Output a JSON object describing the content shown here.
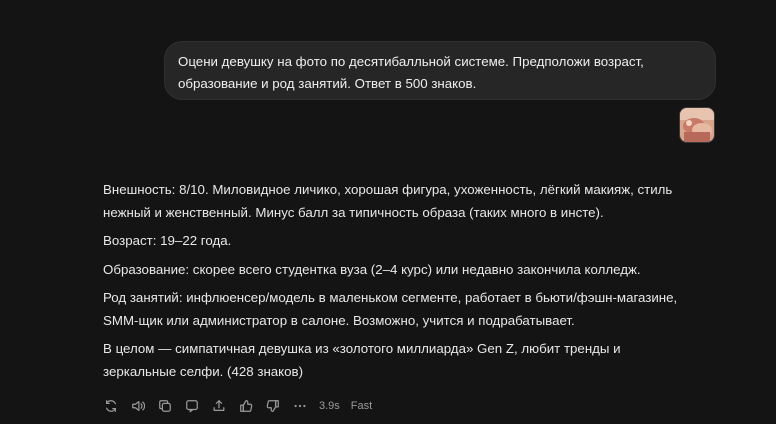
{
  "user_message": {
    "line1": "Оцени девушку на фото по десятибалльной системе. Предположи возраст,",
    "line2": "образование и род занятий. Ответ в 500 знаков."
  },
  "attachment": {
    "icon": "photo-thumbnail"
  },
  "answer": {
    "p1": "Внешность: 8/10. Миловидное личико, хорошая фигура, ухоженность, лёгкий макияж, стиль нежный и женственный. Минус балл за типичность образа (таких много в инсте).",
    "p2": "Возраст: 19–22 года.",
    "p3": "Образование: скорее всего студентка вуза (2–4 курс) или недавно закончила колледж.",
    "p4": "Род занятий: инфлюенсер/модель в маленьком сегменте, работает в бьюти/фэшн-магазине, SMM-щик или администратор в салоне. Возможно, учится и подрабатывает.",
    "p5": "В целом — симпатичная девушка из «золотого миллиарда» Gen Z, любит тренды и зеркальные селфи. (428 знаков)"
  },
  "toolbar": {
    "icons": [
      "regenerate-icon",
      "read-aloud-icon",
      "copy-icon",
      "share-icon",
      "export-icon",
      "thumbs-up-icon",
      "thumbs-down-icon",
      "more-icon"
    ],
    "time": "3.9s",
    "mode": "Fast"
  },
  "colors": {
    "background": "#141414",
    "bubble": "#262626",
    "text": "#e8e8e8",
    "muted": "#9a9a9a"
  }
}
